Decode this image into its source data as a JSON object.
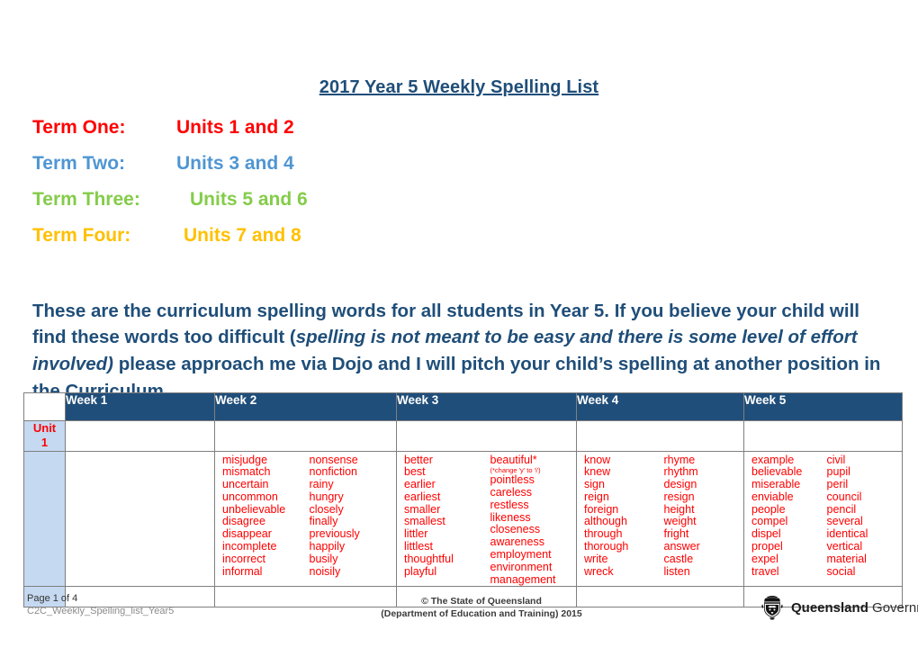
{
  "document": {
    "title": "2017 Year 5 Weekly Spelling List"
  },
  "terms": [
    {
      "label": "Term One:",
      "units": "Units 1 and 2",
      "color": "#ff0000"
    },
    {
      "label": "Term Two:",
      "units": "Units 3 and 4",
      "color": "#4f96d2"
    },
    {
      "label": "Term Three:",
      "units": "Units 5 and 6",
      "color": "#84cc4a"
    },
    {
      "label": "Term Four:",
      "units": "Units 7 and 8",
      "color": "#ffc000"
    }
  ],
  "intro": {
    "part1": "These are the curriculum spelling words for all students in Year 5. If you believe your child will find these words too difficult (",
    "italic": "spelling is not meant to be easy and there is some level of effort involved)",
    "part2": " please approach me via Dojo and I will pitch your child’s spelling at another position in the Curriculum."
  },
  "table": {
    "header_color": "#204e7a",
    "unit_cell_color": "#c5d9f1",
    "word_color": "#ff0000",
    "columns": [
      "Week 1",
      "Week 2",
      "Week 3",
      "Week 4",
      "Week 5"
    ],
    "unit_label_line1": "Unit",
    "unit_label_line2": "1",
    "weeks": [
      {
        "name": "Week 1",
        "col_a": [],
        "col_b": []
      },
      {
        "name": "Week 2",
        "col_a": [
          "misjudge",
          "mismatch",
          "uncertain",
          "uncommon",
          "unbelievable",
          "disagree",
          "disappear",
          "incomplete",
          "incorrect",
          "informal"
        ],
        "col_b": [
          "nonsense",
          "nonfiction",
          "rainy",
          "hungry",
          "closely",
          "finally",
          "previously",
          "happily",
          "busily",
          "noisily"
        ]
      },
      {
        "name": "Week 3",
        "col_a": [
          "better",
          "best",
          "earlier",
          "earliest",
          "smaller",
          "smallest",
          "littler",
          "littlest",
          "thoughtful",
          "playful"
        ],
        "col_b": [
          "beautiful*",
          "pointless",
          "careless",
          "restless",
          "likeness",
          "closeness",
          "awareness",
          "employment",
          "environment",
          "management"
        ],
        "note": "(*change 'y' to 'i')",
        "note_after": "beautiful*"
      },
      {
        "name": "Week 4",
        "col_a": [
          "know",
          "knew",
          "sign",
          "reign",
          "foreign",
          "although",
          "through",
          "thorough",
          "write",
          "wreck"
        ],
        "col_b": [
          "rhyme",
          "rhythm",
          "design",
          "resign",
          "height",
          "weight",
          "fright",
          "answer",
          "castle",
          "listen"
        ]
      },
      {
        "name": "Week 5",
        "col_a": [
          "example",
          "believable",
          "miserable",
          "enviable",
          "people",
          "compel",
          "dispel",
          "propel",
          "expel",
          "travel"
        ],
        "col_b": [
          "civil",
          "pupil",
          "peril",
          "council",
          "pencil",
          "several",
          "identical",
          "vertical",
          "material",
          "social"
        ]
      }
    ]
  },
  "footer": {
    "page": "Page 1 of 4",
    "file": "C2C_Weekly_Spelling_list_Year5",
    "copyright_line1": "© The State of Queensland",
    "copyright_line2": "(Department of Education and Training) 2015",
    "logo_bold": "Queensland",
    "logo_regular": "Government"
  }
}
